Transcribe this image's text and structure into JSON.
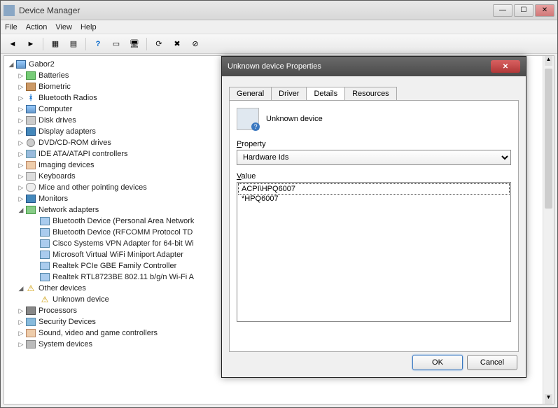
{
  "window": {
    "title": "Device Manager",
    "menu": [
      "File",
      "Action",
      "View",
      "Help"
    ]
  },
  "toolbar_icons": [
    "back",
    "forward",
    "view-list",
    "view-details",
    "help",
    "properties",
    "scan",
    "update",
    "uninstall",
    "disable"
  ],
  "tree": {
    "root": "Gabor2",
    "nodes": [
      {
        "icon": "batt",
        "label": "Batteries",
        "expander": "▷"
      },
      {
        "icon": "finger",
        "label": "Biometric",
        "expander": "▷"
      },
      {
        "icon": "bt",
        "label": "Bluetooth Radios",
        "expander": "▷"
      },
      {
        "icon": "computer",
        "label": "Computer",
        "expander": "▷"
      },
      {
        "icon": "drive",
        "label": "Disk drives",
        "expander": "▷"
      },
      {
        "icon": "display",
        "label": "Display adapters",
        "expander": "▷"
      },
      {
        "icon": "cd",
        "label": "DVD/CD-ROM drives",
        "expander": "▷"
      },
      {
        "icon": "ide",
        "label": "IDE ATA/ATAPI controllers",
        "expander": "▷"
      },
      {
        "icon": "img",
        "label": "Imaging devices",
        "expander": "▷"
      },
      {
        "icon": "kbd",
        "label": "Keyboards",
        "expander": "▷"
      },
      {
        "icon": "mouse",
        "label": "Mice and other pointing devices",
        "expander": "▷"
      },
      {
        "icon": "mon",
        "label": "Monitors",
        "expander": "▷"
      },
      {
        "icon": "net",
        "label": "Network adapters",
        "expander": "◢",
        "children": [
          {
            "icon": "netitem",
            "label": "Bluetooth Device (Personal Area Network"
          },
          {
            "icon": "netitem",
            "label": "Bluetooth Device (RFCOMM Protocol TD"
          },
          {
            "icon": "netitem",
            "label": "Cisco Systems VPN Adapter for 64-bit Wi"
          },
          {
            "icon": "netitem",
            "label": "Microsoft Virtual WiFi Miniport Adapter"
          },
          {
            "icon": "netitem",
            "label": "Realtek PCIe GBE Family Controller"
          },
          {
            "icon": "netitem",
            "label": "Realtek RTL8723BE 802.11 b/g/n Wi-Fi A"
          }
        ]
      },
      {
        "icon": "warn",
        "label": "Other devices",
        "expander": "◢",
        "children": [
          {
            "icon": "warn",
            "label": "Unknown device"
          }
        ]
      },
      {
        "icon": "cpu",
        "label": "Processors",
        "expander": "▷"
      },
      {
        "icon": "sec",
        "label": "Security Devices",
        "expander": "▷"
      },
      {
        "icon": "snd",
        "label": "Sound, video and game controllers",
        "expander": "▷"
      },
      {
        "icon": "sys",
        "label": "System devices",
        "expander": "▷"
      }
    ]
  },
  "dialog": {
    "title": "Unknown device Properties",
    "tabs": [
      "General",
      "Driver",
      "Details",
      "Resources"
    ],
    "active_tab": "Details",
    "device_name": "Unknown device",
    "property_label": "Property",
    "property_selected": "Hardware Ids",
    "value_label": "Value",
    "values": [
      "ACPI\\HPQ6007",
      "*HPQ6007"
    ],
    "ok": "OK",
    "cancel": "Cancel"
  }
}
